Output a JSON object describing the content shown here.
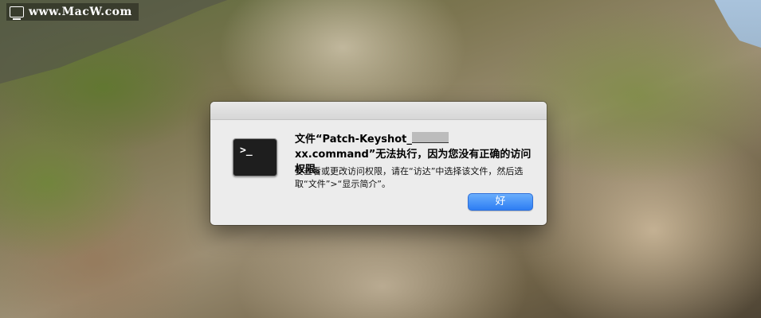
{
  "watermark": {
    "text": "www.MacW.com",
    "icon": "monitor-icon"
  },
  "dialog": {
    "title_before": "文件“Patch-Keyshot_",
    "title_after": "xx.command”无法执行，因为您没有正确的访问权限。",
    "message": "要查看或更改访问权限，请在“访达”中选择该文件，然后选取“文件”>“显示简介”。",
    "ok_label": "好",
    "app_icon": "terminal-icon",
    "app_icon_glyph": ">_"
  },
  "colors": {
    "button_accent": "#2d7df3",
    "dialog_bg": "#ececec"
  }
}
